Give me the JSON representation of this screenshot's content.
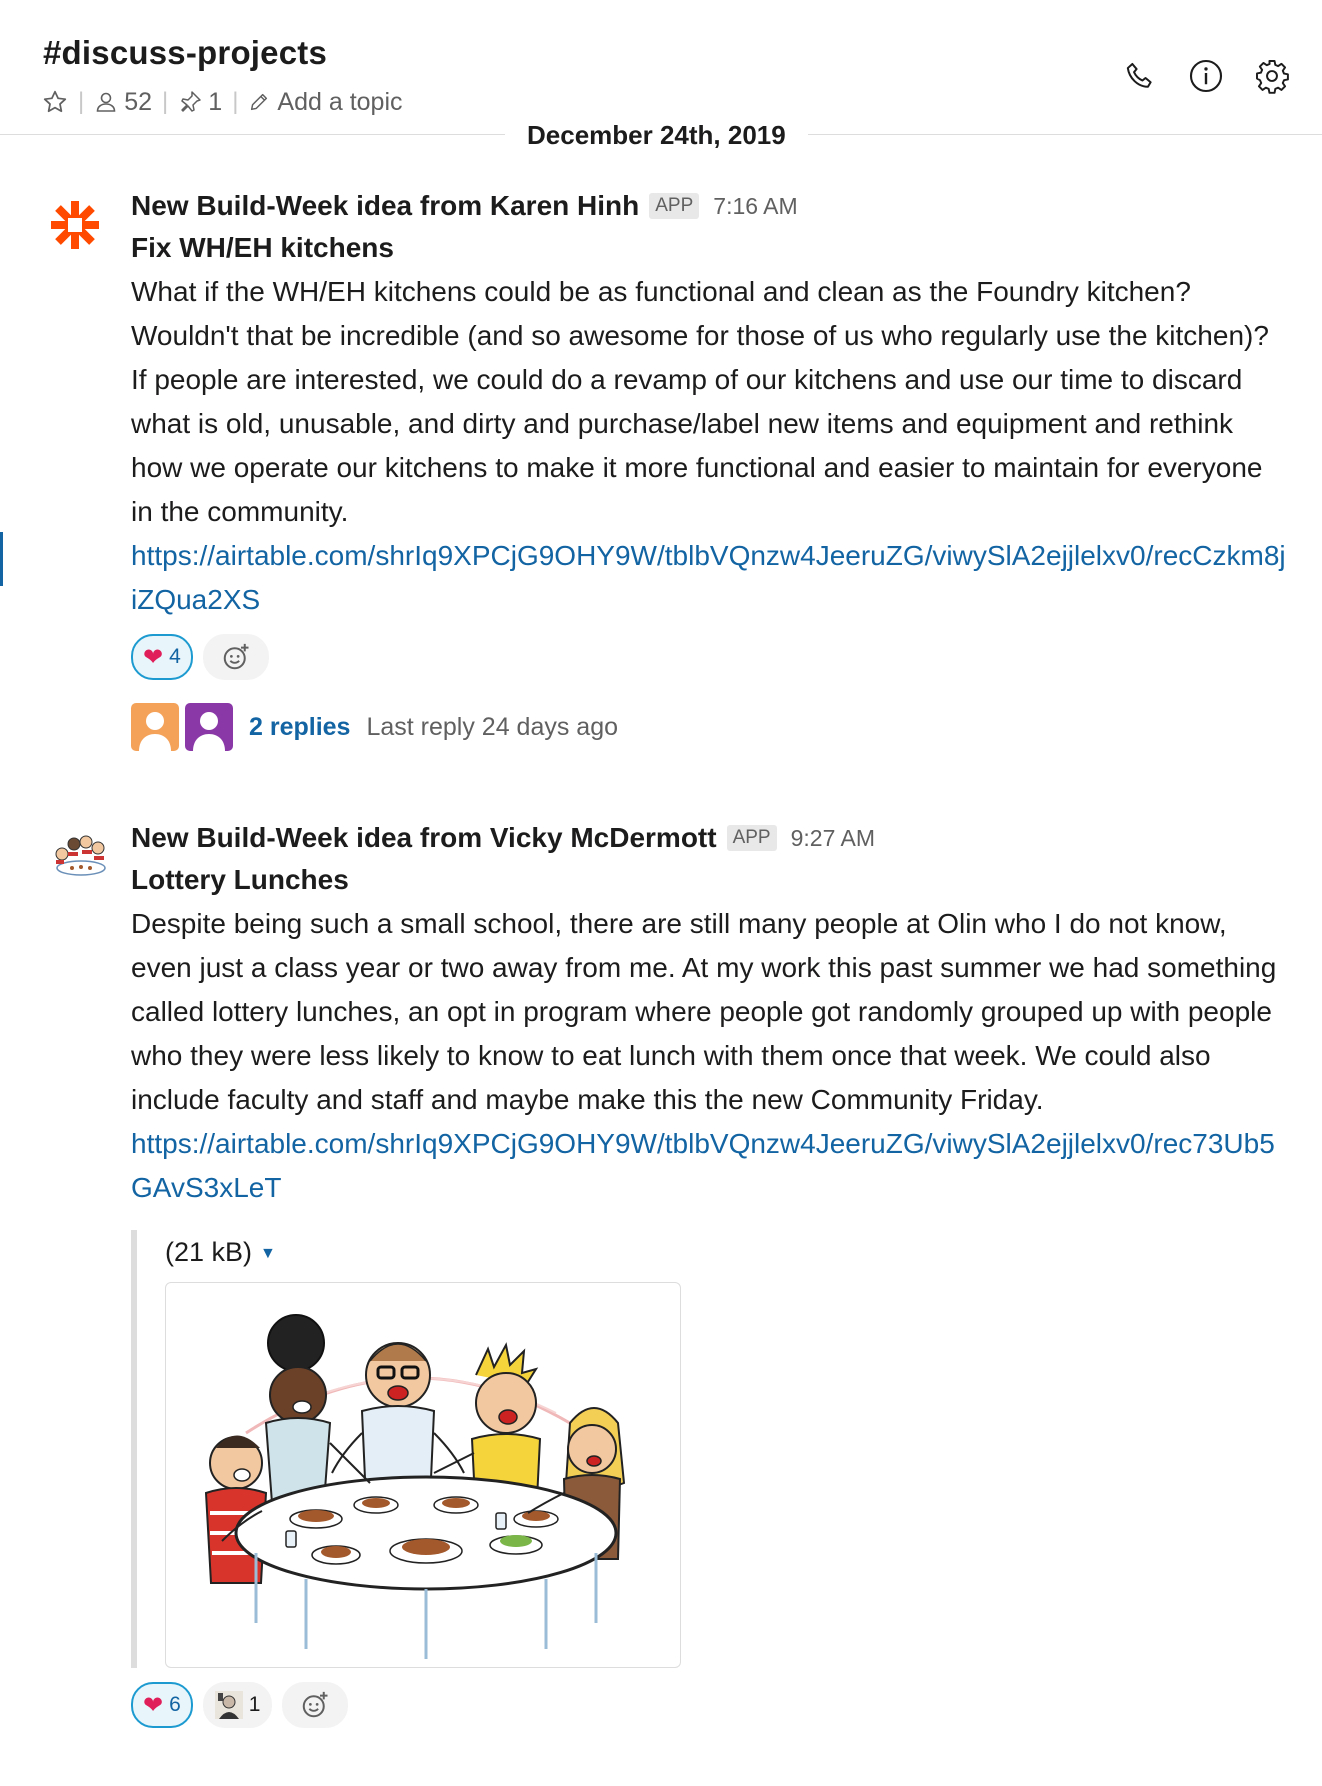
{
  "channel": {
    "name": "#discuss-projects",
    "members": "52",
    "pins": "1",
    "topic_placeholder": "Add a topic"
  },
  "date_divider": "December 24th, 2019",
  "messages": [
    {
      "sender": "New Build-Week idea from Karen Hinh",
      "badge": "APP",
      "time": "7:16 AM",
      "title": "Fix WH/EH kitchens",
      "paragraph1": "What if the WH/EH kitchens could be as functional and clean as the Foundry kitchen? Wouldn't that be incredible (and so awesome for those of us who regularly use the kitchen)?",
      "paragraph2": "If people are interested, we could do a revamp of our kitchens and use our time to discard what is old, unusable, and dirty and purchase/label new items and equipment and rethink how we operate our kitchens to make it more functional and easier to maintain for everyone in the community.",
      "link": "https://airtable.com/shrIq9XPCjG9OHY9W/tblbVQnzw4JeeruZG/viwySlA2ejjlelxv0/recCzkm8jiZQua2XS",
      "reaction_heart_count": "4",
      "replies": "2 replies",
      "last_reply": "Last reply 24 days ago"
    },
    {
      "sender": "New Build-Week idea from Vicky McDermott",
      "badge": "APP",
      "time": "9:27 AM",
      "title": "Lottery Lunches",
      "paragraph1": "Despite being such a small school, there are still many people at Olin who I do not know, even just a class year or two away from me. At my work this past summer we had something called lottery lunches, an opt in program where people got randomly grouped up with people who they were less likely to know to eat lunch with them once that week. We could also include faculty and staff and maybe make this the new Community Friday.",
      "link": "https://airtable.com/shrIq9XPCjG9OHY9W/tblbVQnzw4JeeruZG/viwySlA2ejjlelxv0/rec73Ub5GAvS3xLeT",
      "attachment_size": "(21 kB)",
      "reaction_heart_count": "6",
      "reaction_custom_count": "1"
    }
  ],
  "colors": {
    "link": "#1264a3",
    "zapier": "#ff4a00",
    "heart": "#e01e5a"
  }
}
